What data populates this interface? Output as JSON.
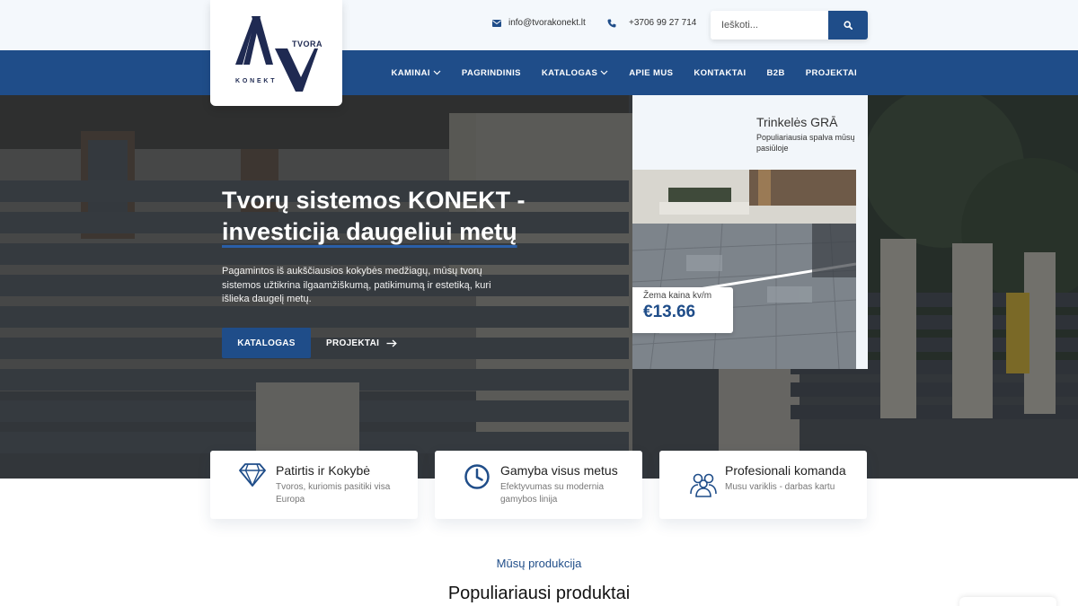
{
  "logo": {
    "top_word": "TVORA",
    "bottom_word": "KONEKT",
    "icon": "av-logo-icon"
  },
  "contact": {
    "email": "info@tvorakonekt.lt",
    "phone": "+3706 99 27 714"
  },
  "search": {
    "placeholder": "Ieškoti..."
  },
  "nav": {
    "items": [
      {
        "label": "KAMINAI",
        "has_dropdown": true
      },
      {
        "label": "PAGRINDINIS",
        "has_dropdown": false
      },
      {
        "label": "KATALOGAS",
        "has_dropdown": true
      },
      {
        "label": "APIE MUS",
        "has_dropdown": false
      },
      {
        "label": "KONTAKTAI",
        "has_dropdown": false
      },
      {
        "label": "B2B",
        "has_dropdown": false
      },
      {
        "label": "PROJEKTAI",
        "has_dropdown": false
      }
    ]
  },
  "hero": {
    "title_line1": "Tvorų sistemos KONEKT -",
    "title_line2": "investicija daugeliui metų",
    "description": "Pagamintos iš aukščiausios kokybės medžiagų, mūsų tvorų sistemos užtikrina ilgaamžiškumą, patikimumą ir estetiką, kuri išlieka daugelį metų.",
    "primary_button": "KATALOGAS",
    "secondary_button": "PROJEKTAI"
  },
  "promo": {
    "title": "Trinkelės GRĀ",
    "subtitle": "Populiariausia spalva mūsų pasiūloje",
    "price_label": "Žema kaina kv/m",
    "price": "€13.66"
  },
  "features": [
    {
      "icon": "diamond-icon",
      "title": "Patirtis ir Kokybė",
      "desc": "Tvoros, kuriomis pasitiki visa Europa"
    },
    {
      "icon": "clock-icon",
      "title": "Gamyba visus metus",
      "desc": "Efektyvumas su modernia gamybos linija"
    },
    {
      "icon": "team-icon",
      "title": "Profesionali komanda",
      "desc": "Musu variklis - darbas kartu"
    }
  ],
  "products": {
    "subtitle": "Mūsų produkcija",
    "title": "Populiariausi produktai"
  },
  "colors": {
    "primary": "#1f4d89",
    "topbar_bg": "#f4f8fc",
    "white": "#ffffff"
  }
}
